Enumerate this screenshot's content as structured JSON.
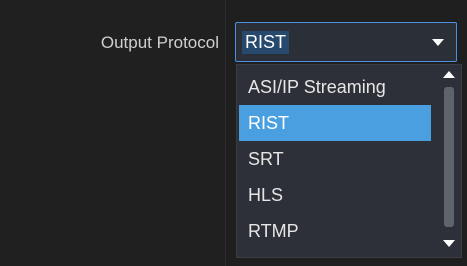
{
  "form": {
    "output_protocol_label": "Output Protocol"
  },
  "dropdown": {
    "selected_value": "RIST",
    "options": [
      "ASI/IP Streaming",
      "RIST",
      "SRT",
      "HLS",
      "RTMP"
    ],
    "highlighted_option": "RIST",
    "open": true
  },
  "colors": {
    "accent": "#4a90e2",
    "highlight": "#4a9fe0",
    "background": "#202020"
  },
  "icons": {
    "select_arrow": "chevron-down-icon",
    "scroll_up": "scroll-up-arrow-icon",
    "scroll_down": "scroll-down-arrow-icon"
  }
}
